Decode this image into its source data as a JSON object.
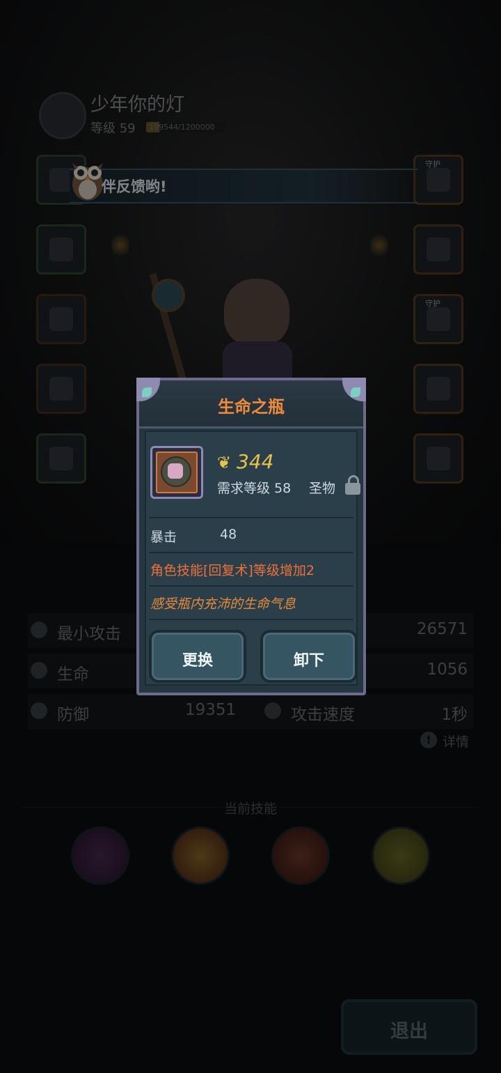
{
  "player": {
    "name": "少年你的灯",
    "level_label": "等级 59",
    "xp_text": "199544/1200000",
    "xp_fraction": 0.166
  },
  "banner": {
    "text": "伴反馈哟!"
  },
  "equipment": {
    "left_slots": [
      "helmet",
      "armor",
      "boots",
      "bracer",
      "cloak"
    ],
    "right_slots": [
      {
        "icon": "staff-weapon-icon",
        "tag": "守护"
      },
      {
        "icon": "ring-icon",
        "tag": ""
      },
      {
        "icon": "necklace-icon",
        "tag": "守护"
      },
      {
        "icon": "gauntlet-icon",
        "tag": ""
      },
      {
        "icon": "relic-bottle-icon",
        "tag": ""
      }
    ]
  },
  "stats": {
    "rows": [
      {
        "left_label": "最小攻击",
        "left_value": "",
        "right_label": "",
        "right_value": "26571"
      },
      {
        "left_label": "生命",
        "left_value": "",
        "right_label": "",
        "right_value": "1056"
      },
      {
        "left_label": "防御",
        "left_value": "19351",
        "right_label": "攻击速度",
        "right_value": "1秒"
      }
    ],
    "detail_label": "详情"
  },
  "skills": {
    "title": "当前技能",
    "icons": [
      "sword-skill-icon",
      "explosion-skill-icon",
      "axes-skill-icon",
      "bubbles-skill-icon"
    ]
  },
  "exit_label": "退出",
  "popup": {
    "title": "生命之瓶",
    "power": "344",
    "required_level": "需求等级 58",
    "type": "圣物",
    "attr_label": "暴击",
    "attr_value": "48",
    "effect": "角色技能[回复术]等级增加2",
    "flavor": "感受瓶内充沛的生命气息",
    "replace_label": "更换",
    "unequip_label": "卸下"
  },
  "colors": {
    "title_orange": "#f08a3c",
    "power_gold": "#e7c24a",
    "effect_orange": "#f0703a",
    "frame_purple": "#8e8ab2"
  }
}
